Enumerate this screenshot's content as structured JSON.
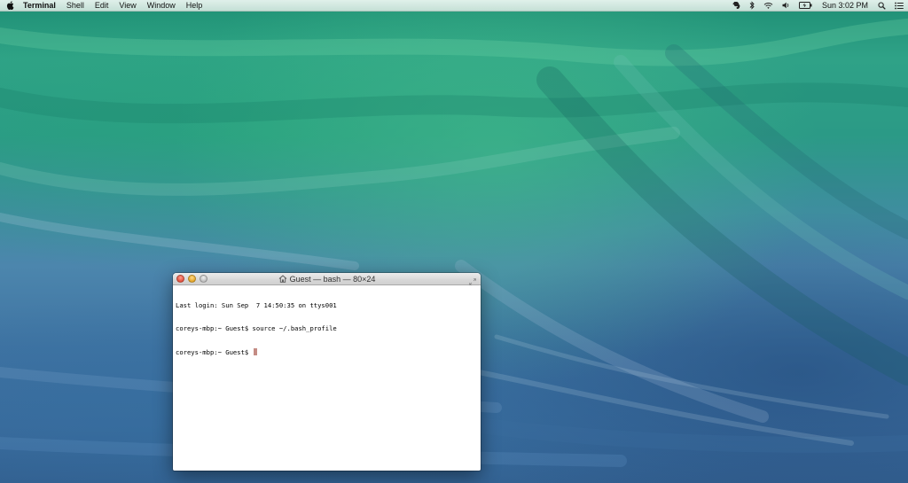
{
  "menubar": {
    "apple_icon": "apple-icon",
    "app_name": "Terminal",
    "menus": [
      "Shell",
      "Edit",
      "View",
      "Window",
      "Help"
    ],
    "status_icons": [
      "evernote-icon",
      "bluetooth-icon",
      "wifi-icon",
      "volume-icon",
      "battery-icon"
    ],
    "clock": "Sun 3:02 PM",
    "search_icon": "spotlight-search-icon",
    "notification_icon": "notification-center-icon"
  },
  "terminal": {
    "title": "Guest — bash — 80×24",
    "title_icon": "home-folder-icon",
    "lines": [
      "Last login: Sun Sep  7 14:50:35 on ttys001",
      "coreys-mbp:~ Guest$ source ~/.bash_profile",
      "coreys-mbp:~ Guest$ "
    ],
    "cursor_color": "#c48c84"
  },
  "colors": {
    "wallpaper_top": "#2fa287",
    "wallpaper_bottom": "#335f8f",
    "close_button": "#e2503e",
    "minimize_button": "#e3a526"
  }
}
